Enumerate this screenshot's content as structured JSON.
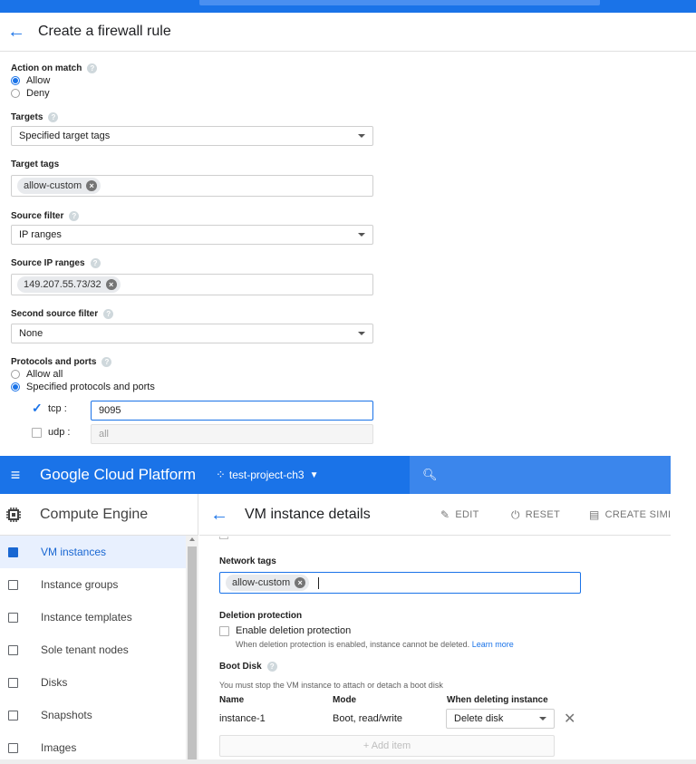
{
  "firewall": {
    "title": "Create a firewall rule",
    "action_on_match": {
      "label": "Action on match",
      "options": [
        "Allow",
        "Deny"
      ],
      "selected": "Allow"
    },
    "targets": {
      "label": "Targets",
      "value": "Specified target tags"
    },
    "target_tags": {
      "label": "Target tags",
      "chip": "allow-custom"
    },
    "source_filter": {
      "label": "Source filter",
      "value": "IP ranges"
    },
    "source_ip_ranges": {
      "label": "Source IP ranges",
      "chip": "149.207.55.73/32"
    },
    "second_source_filter": {
      "label": "Second source filter",
      "value": "None"
    },
    "protocols": {
      "label": "Protocols and ports",
      "options": [
        "Allow all",
        "Specified protocols and ports"
      ],
      "selected": "Specified protocols and ports",
      "tcp": {
        "label": "tcp :",
        "checked": true,
        "value": "9095"
      },
      "udp": {
        "label": "udp :",
        "checked": false,
        "placeholder": "all"
      }
    }
  },
  "gcp": {
    "brand": "Google Cloud Platform",
    "project": "test-project-ch3",
    "sidebar": {
      "title": "Compute Engine",
      "items": [
        {
          "label": "VM instances",
          "active": true
        },
        {
          "label": "Instance groups"
        },
        {
          "label": "Instance templates"
        },
        {
          "label": "Sole tenant nodes"
        },
        {
          "label": "Disks"
        },
        {
          "label": "Snapshots"
        },
        {
          "label": "Images"
        }
      ]
    },
    "page_title": "VM instance details",
    "actions": {
      "edit": "EDIT",
      "reset": "RESET",
      "create_similar": "CREATE SIMI"
    },
    "network_tags": {
      "label": "Network tags",
      "chip": "allow-custom"
    },
    "deletion_protection": {
      "label": "Deletion protection",
      "checkbox_label": "Enable deletion protection",
      "note": "When deletion protection is enabled, instance cannot be deleted.",
      "learn_more": "Learn more"
    },
    "boot_disk": {
      "label": "Boot Disk",
      "note": "You must stop the VM instance to attach or detach a boot disk",
      "headers": [
        "Name",
        "Mode",
        "When deleting instance"
      ],
      "row": {
        "name": "instance-1",
        "mode": "Boot, read/write",
        "when_deleting": "Delete disk"
      },
      "add_item": "+ Add item"
    }
  },
  "colors": {
    "accent": "#1a73e8",
    "active_bg": "#e8f0fe"
  }
}
